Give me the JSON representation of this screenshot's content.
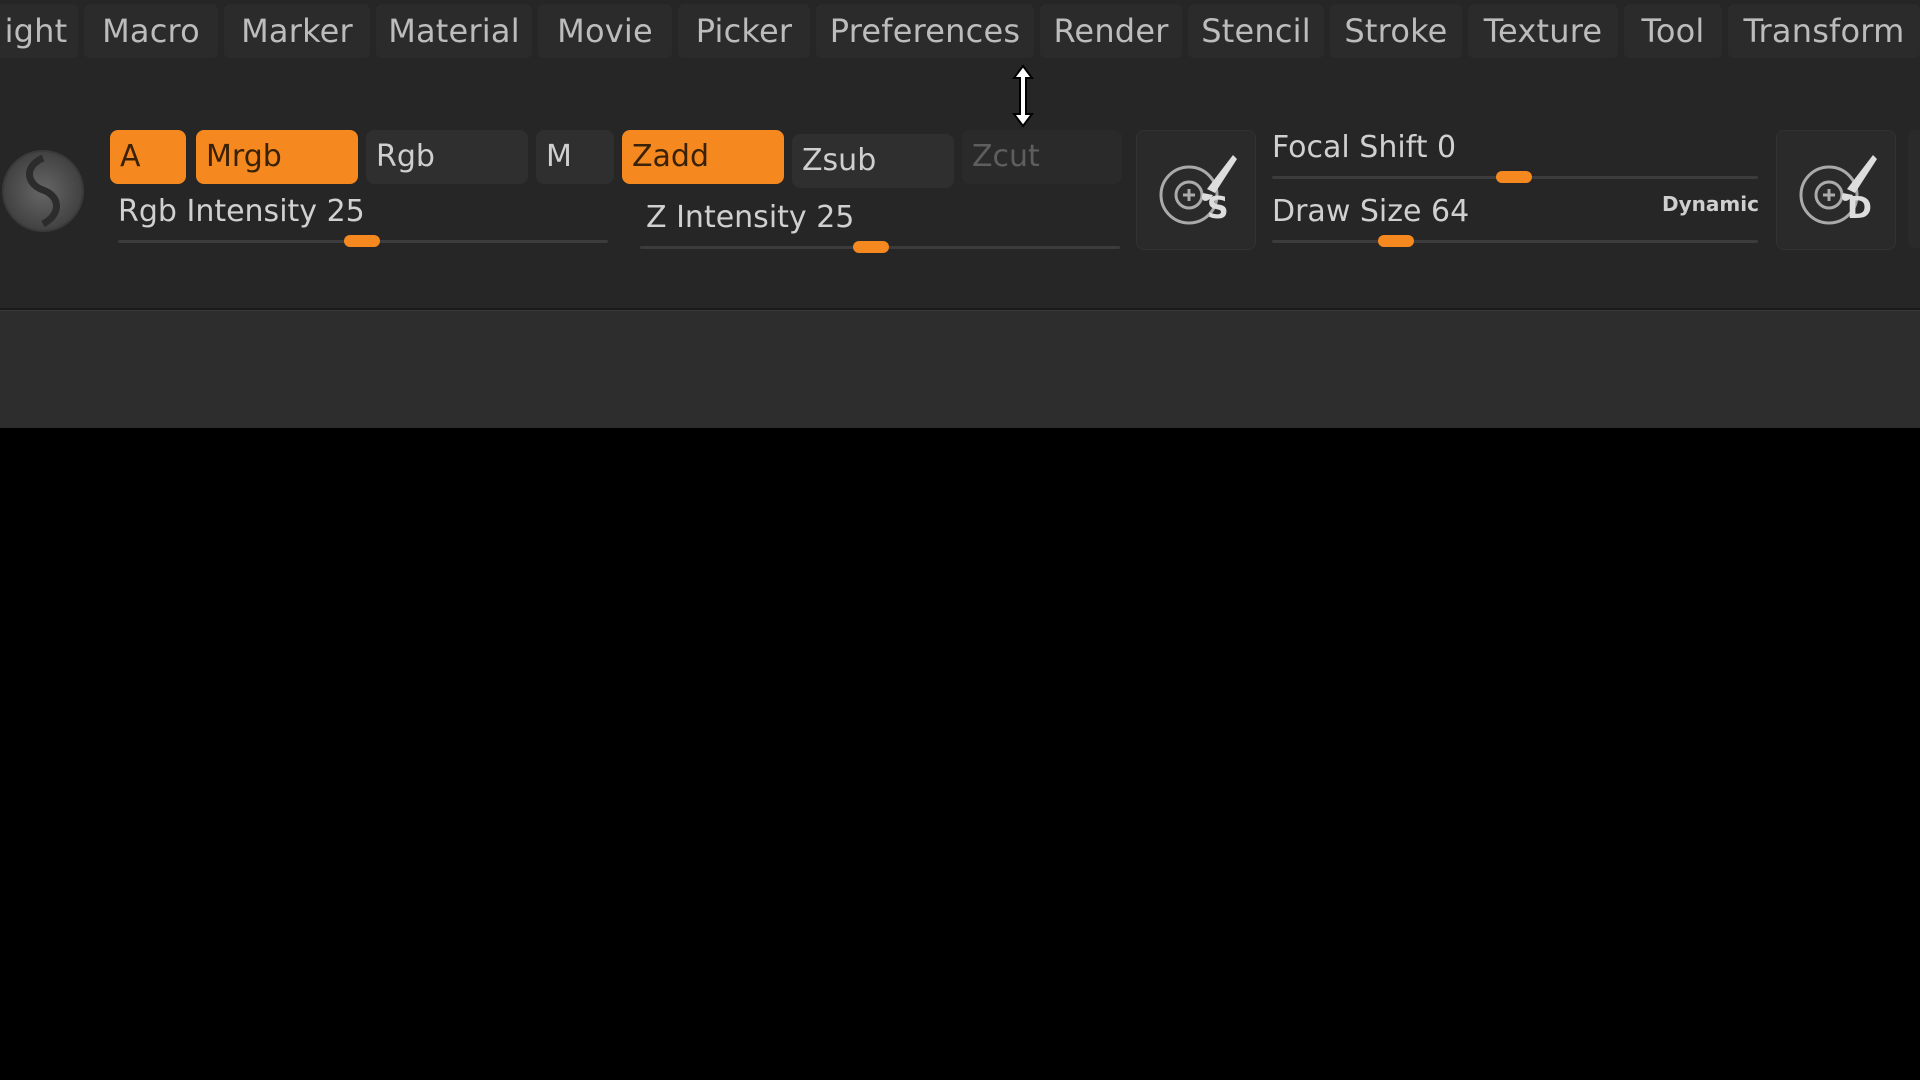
{
  "menu": {
    "items": [
      "ight",
      "Macro",
      "Marker",
      "Material",
      "Movie",
      "Picker",
      "Preferences",
      "Render",
      "Stencil",
      "Stroke",
      "Texture",
      "Tool",
      "Transform"
    ]
  },
  "toolbar": {
    "a_label": "A",
    "mrgb_label": "Mrgb",
    "rgb_label": "Rgb",
    "m_label": "M",
    "zadd_label": "Zadd",
    "zsub_label": "Zsub",
    "zcut_label": "Zcut",
    "rgb_intensity_label": "Rgb Intensity",
    "rgb_intensity_value": "25",
    "z_intensity_label": "Z Intensity",
    "z_intensity_value": "25",
    "focal_shift_label": "Focal Shift",
    "focal_shift_value": "0",
    "draw_size_label": "Draw Size",
    "draw_size_value": "64",
    "dynamic_label": "Dynamic",
    "lightbox_s_label": "S",
    "lightbox_d_label": "D"
  },
  "colors": {
    "accent": "#f5891f",
    "panel": "#262626",
    "canvas": "#000000"
  },
  "icons": [
    "material-sphere-icon",
    "brush-s-icon",
    "brush-d-icon",
    "resize-vertical-cursor-icon"
  ]
}
